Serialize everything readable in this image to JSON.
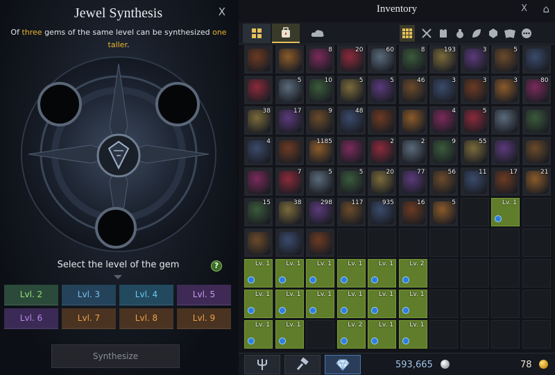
{
  "synthesis": {
    "title": "Jewel Synthesis",
    "close": "X",
    "desc_of": "Of",
    "desc_three": "three",
    "desc_mid": " gems of the same level can be synthesized",
    "desc_one": "one",
    "desc_taller": "taller",
    "desc_end": ".",
    "select_label": "Select the level of the gem",
    "help": "?",
    "levels": [
      {
        "label": "Lvl. 2",
        "bg": "#2b4a3a",
        "fg": "#9be07a"
      },
      {
        "label": "Lvl. 3",
        "bg": "#24425a",
        "fg": "#7fc0ee"
      },
      {
        "label": "Lvl. 4",
        "bg": "#22495e",
        "fg": "#6ec9f0"
      },
      {
        "label": "Lvl. 5",
        "bg": "#3e2a55",
        "fg": "#c89af0"
      },
      {
        "label": "Lvl. 6",
        "bg": "#3a2a55",
        "fg": "#b98af0"
      },
      {
        "label": "Lvl. 7",
        "bg": "#4a3320",
        "fg": "#f0a050"
      },
      {
        "label": "Lvl. 8",
        "bg": "#4a3320",
        "fg": "#f0a050"
      },
      {
        "label": "Lvl. 9",
        "bg": "#4a3320",
        "fg": "#f0a050"
      }
    ],
    "button": "Synthesize"
  },
  "inventory": {
    "title": "Inventory",
    "close": "X",
    "silver": "593,665",
    "gold": "78",
    "tabs": [
      "grid-icon",
      "bag-icon",
      "cloud-icon"
    ],
    "filters": [
      "all-grid-icon",
      "swords-icon",
      "armor-icon",
      "potion-icon",
      "leaf-icon",
      "gem-icon",
      "cards-icon",
      "more-icon"
    ],
    "rows": [
      [
        {
          "c": "",
          "k": "item"
        },
        {
          "c": "",
          "k": "item"
        },
        {
          "c": "8",
          "k": "item"
        },
        {
          "c": "20",
          "k": "item"
        },
        {
          "c": "60",
          "k": "item"
        },
        {
          "c": "8",
          "k": "item"
        },
        {
          "c": "193",
          "k": "item"
        },
        {
          "c": "3",
          "k": "item"
        },
        {
          "c": "5",
          "k": "item"
        },
        {
          "c": "",
          "k": "item"
        }
      ],
      [
        {
          "c": "",
          "k": "item"
        },
        {
          "c": "5",
          "k": "item"
        },
        {
          "c": "10",
          "k": "item"
        },
        {
          "c": "5",
          "k": "item"
        },
        {
          "c": "5",
          "k": "item"
        },
        {
          "c": "46",
          "k": "item"
        },
        {
          "c": "3",
          "k": "item"
        },
        {
          "c": "3",
          "k": "item"
        },
        {
          "c": "3",
          "k": "item"
        },
        {
          "c": "80",
          "k": "item"
        }
      ],
      [
        {
          "c": "38",
          "k": "item"
        },
        {
          "c": "17",
          "k": "item"
        },
        {
          "c": "9",
          "k": "item"
        },
        {
          "c": "48",
          "k": "item"
        },
        {
          "c": "",
          "k": "item"
        },
        {
          "c": "",
          "k": "item"
        },
        {
          "c": "4",
          "k": "item"
        },
        {
          "c": "5",
          "k": "item"
        },
        {
          "c": "",
          "k": "item"
        },
        {
          "c": "",
          "k": "item"
        }
      ],
      [
        {
          "c": "4",
          "k": "item"
        },
        {
          "c": "",
          "k": "item"
        },
        {
          "c": "1185",
          "k": "item"
        },
        {
          "c": "",
          "k": "item"
        },
        {
          "c": "2",
          "k": "item"
        },
        {
          "c": "2",
          "k": "item"
        },
        {
          "c": "9",
          "k": "item"
        },
        {
          "c": "55",
          "k": "item"
        },
        {
          "c": "",
          "k": "item"
        },
        {
          "c": "",
          "k": "item"
        }
      ],
      [
        {
          "c": "",
          "k": "item"
        },
        {
          "c": "7",
          "k": "item"
        },
        {
          "c": "5",
          "k": "item"
        },
        {
          "c": "5",
          "k": "item"
        },
        {
          "c": "20",
          "k": "item"
        },
        {
          "c": "77",
          "k": "item"
        },
        {
          "c": "56",
          "k": "item"
        },
        {
          "c": "11",
          "k": "item"
        },
        {
          "c": "17",
          "k": "item"
        },
        {
          "c": "21",
          "k": "item"
        }
      ],
      [
        {
          "c": "15",
          "k": "item"
        },
        {
          "c": "38",
          "k": "item"
        },
        {
          "c": "298",
          "k": "item"
        },
        {
          "c": "117",
          "k": "item"
        },
        {
          "c": "935",
          "k": "item"
        },
        {
          "c": "16",
          "k": "item"
        },
        {
          "c": "5",
          "k": "item"
        },
        {
          "c": "",
          "k": "empty"
        },
        {
          "c": "Lv. 1",
          "k": "gem"
        },
        {
          "c": "",
          "k": "empty"
        }
      ],
      [
        {
          "c": "",
          "k": "item"
        },
        {
          "c": "",
          "k": "item"
        },
        {
          "c": "",
          "k": "item"
        },
        {
          "c": "",
          "k": "empty"
        },
        {
          "c": "",
          "k": "empty"
        },
        {
          "c": "",
          "k": "empty"
        },
        {
          "c": "",
          "k": "empty"
        },
        {
          "c": "",
          "k": "empty"
        },
        {
          "c": "",
          "k": "empty"
        },
        {
          "c": "",
          "k": "empty"
        }
      ],
      [
        {
          "c": "Lv. 1",
          "k": "gem"
        },
        {
          "c": "Lv. 1",
          "k": "gem"
        },
        {
          "c": "Lv. 1",
          "k": "gem"
        },
        {
          "c": "Lv. 1",
          "k": "gem"
        },
        {
          "c": "Lv. 1",
          "k": "gem"
        },
        {
          "c": "Lv. 2",
          "k": "gem"
        },
        {
          "c": "",
          "k": "empty"
        },
        {
          "c": "",
          "k": "empty"
        },
        {
          "c": "",
          "k": "empty"
        },
        {
          "c": "",
          "k": "empty"
        }
      ],
      [
        {
          "c": "Lv. 1",
          "k": "gem"
        },
        {
          "c": "Lv. 1",
          "k": "gem"
        },
        {
          "c": "Lv. 1",
          "k": "gem"
        },
        {
          "c": "Lv. 1",
          "k": "gem"
        },
        {
          "c": "Lv. 1",
          "k": "gem"
        },
        {
          "c": "Lv. 1",
          "k": "gem"
        },
        {
          "c": "",
          "k": "empty"
        },
        {
          "c": "",
          "k": "empty"
        },
        {
          "c": "",
          "k": "empty"
        },
        {
          "c": "",
          "k": "empty"
        }
      ],
      [
        {
          "c": "Lv. 1",
          "k": "gem"
        },
        {
          "c": "Lv. 1",
          "k": "gem"
        },
        {
          "c": "",
          "k": "empty"
        },
        {
          "c": "Lv. 2",
          "k": "gem"
        },
        {
          "c": "Lv. 1",
          "k": "gem"
        },
        {
          "c": "Lv. 1",
          "k": "gem"
        },
        {
          "c": "",
          "k": "empty"
        },
        {
          "c": "",
          "k": "empty"
        },
        {
          "c": "",
          "k": "empty"
        },
        {
          "c": "",
          "k": "empty"
        }
      ]
    ],
    "item_colors": [
      "#6b3a22",
      "#8a5a2a",
      "#7a2a5a",
      "#8a2a3a",
      "#5a6a7a",
      "#3a5a3a",
      "#7a6a3a",
      "#5a3a7a",
      "#6a4a2a",
      "#3a4a6a"
    ]
  }
}
